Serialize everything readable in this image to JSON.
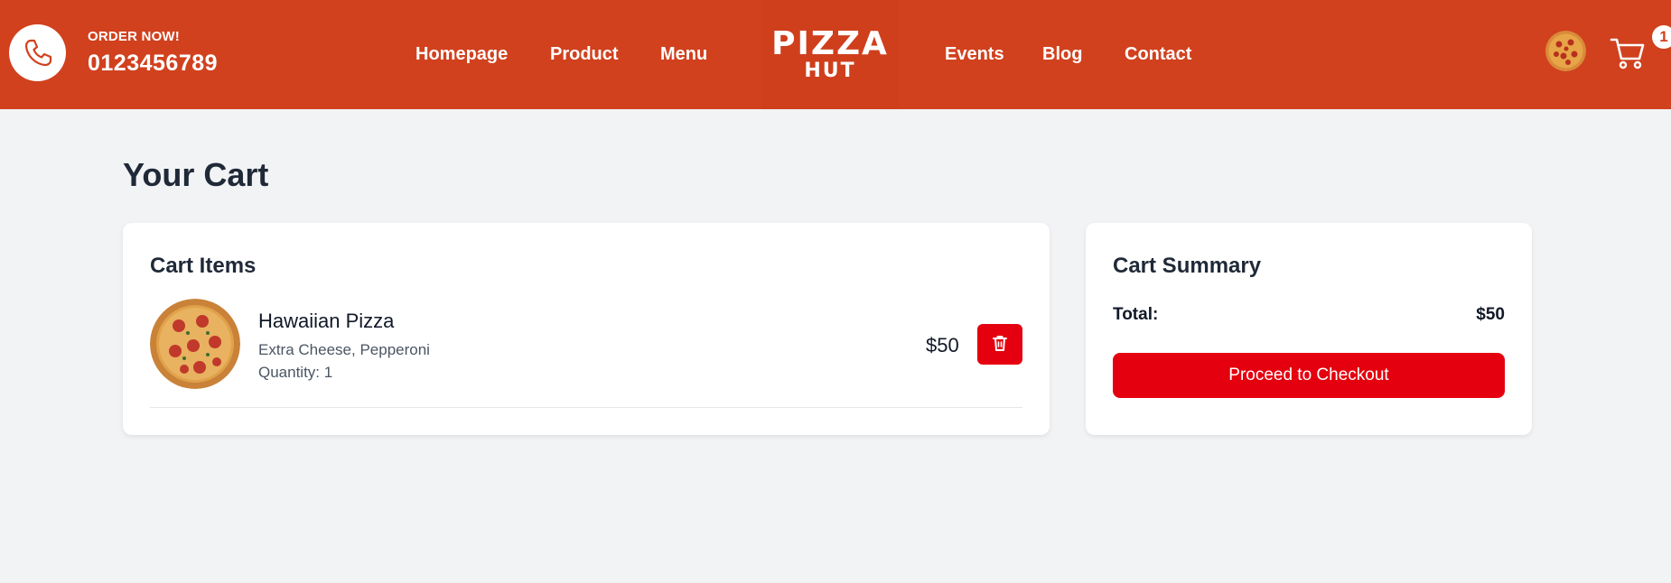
{
  "header": {
    "order_label": "ORDER NOW!",
    "phone_number": "0123456789",
    "nav_left": [
      "Homepage",
      "Product",
      "Menu"
    ],
    "logo_line1": "PIZZA",
    "logo_line2": "HUT",
    "nav_right": [
      "Events",
      "Blog",
      "Contact"
    ],
    "cart_count": "1",
    "brand_color": "#d1411e"
  },
  "page": {
    "title": "Your Cart"
  },
  "cart_items": {
    "title": "Cart Items",
    "items": [
      {
        "name": "Hawaiian Pizza",
        "options": "Extra Cheese, Pepperoni",
        "quantity": "Quantity: 1",
        "price": "$50",
        "image_icon": "pizza-image"
      }
    ]
  },
  "summary": {
    "title": "Cart Summary",
    "total_label": "Total:",
    "total_value": "$50",
    "checkout_label": "Proceed to Checkout",
    "button_color": "#e5000f"
  }
}
